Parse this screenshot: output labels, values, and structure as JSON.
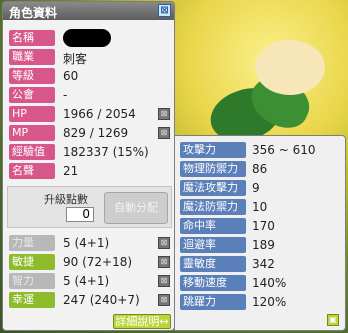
{
  "window": {
    "title": "角色資料",
    "close_icon": "⊠"
  },
  "profile": [
    {
      "label": "名稱",
      "value": "",
      "color": "pink"
    },
    {
      "label": "職業",
      "value": "刺客",
      "color": "pink"
    },
    {
      "label": "等級",
      "value": "60",
      "color": "pink"
    },
    {
      "label": "公會",
      "value": "-",
      "color": "pink"
    },
    {
      "label": "HP",
      "value": "1966 / 2054",
      "color": "pink",
      "button": true
    },
    {
      "label": "MP",
      "value": "829 / 1269",
      "color": "pink",
      "button": true
    },
    {
      "label": "經驗值",
      "value": "182337 (15%)",
      "color": "pink"
    },
    {
      "label": "名聲",
      "value": "21",
      "color": "pink"
    }
  ],
  "ability_points": {
    "label": "升級點數",
    "value": "0",
    "auto_label": "自動分配"
  },
  "stats": [
    {
      "label": "力量",
      "value": "5 (4+1)",
      "color": "gray"
    },
    {
      "label": "敏捷",
      "value": "90 (72+18)",
      "color": "green"
    },
    {
      "label": "智力",
      "value": "5 (4+1)",
      "color": "gray"
    },
    {
      "label": "幸運",
      "value": "247 (240+7)",
      "color": "green"
    }
  ],
  "detail_button": "詳細說明↔",
  "details": [
    {
      "label": "攻擊力",
      "value": "356 ~ 610"
    },
    {
      "label": "物理防禦力",
      "value": "86"
    },
    {
      "label": "魔法攻擊力",
      "value": "9"
    },
    {
      "label": "魔法防禦力",
      "value": "10"
    },
    {
      "label": "命中率",
      "value": "170"
    },
    {
      "label": "迴避率",
      "value": "189"
    },
    {
      "label": "靈敏度",
      "value": "342"
    },
    {
      "label": "移動速度",
      "value": "140%"
    },
    {
      "label": "跳躍力",
      "value": "120%"
    }
  ],
  "colors": {
    "pink_label": "#d8578a",
    "green_label": "#8dbb2c",
    "blue_label": "#5b7fb8"
  }
}
